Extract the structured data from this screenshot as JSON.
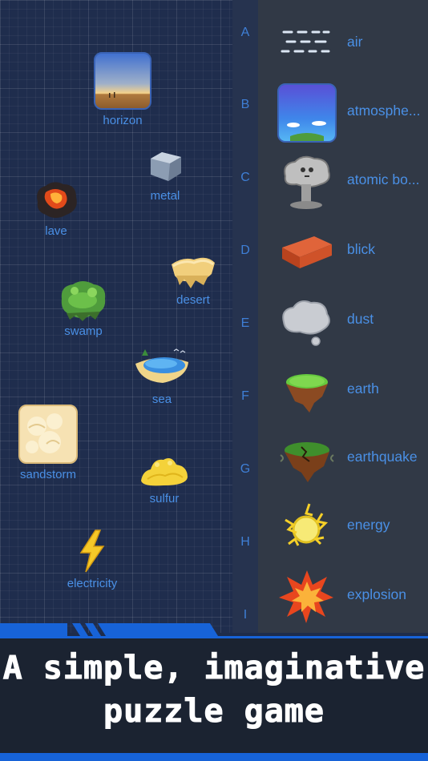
{
  "board": {
    "items": [
      {
        "label": "horizon",
        "icon": "horizon-icon"
      },
      {
        "label": "metal",
        "icon": "metal-icon"
      },
      {
        "label": "lave",
        "icon": "lava-icon"
      },
      {
        "label": "desert",
        "icon": "desert-icon"
      },
      {
        "label": "swamp",
        "icon": "swamp-icon"
      },
      {
        "label": "sea",
        "icon": "sea-icon"
      },
      {
        "label": "sandstorm",
        "icon": "sandstorm-icon"
      },
      {
        "label": "sulfur",
        "icon": "sulfur-icon"
      },
      {
        "label": "electricity",
        "icon": "electricity-icon"
      }
    ]
  },
  "alphabet": [
    "A",
    "B",
    "C",
    "D",
    "E",
    "F",
    "G",
    "H",
    "I"
  ],
  "elements": [
    {
      "label": "air",
      "icon": "air-icon"
    },
    {
      "label": "atmosphe...",
      "icon": "atmosphere-icon"
    },
    {
      "label": "atomic bo...",
      "icon": "atomic-bomb-icon"
    },
    {
      "label": "blick",
      "icon": "brick-icon"
    },
    {
      "label": "dust",
      "icon": "dust-icon"
    },
    {
      "label": "earth",
      "icon": "earth-icon"
    },
    {
      "label": "earthquake",
      "icon": "earthquake-icon"
    },
    {
      "label": "energy",
      "icon": "energy-icon"
    },
    {
      "label": "explosion",
      "icon": "explosion-icon"
    }
  ],
  "banner": {
    "line1": "A simple, imaginative",
    "line2": "puzzle game"
  },
  "colors": {
    "label": "#4a90e6",
    "accent": "#1763d8",
    "board_bg": "#1f2d4d",
    "list_bg": "#313946"
  }
}
